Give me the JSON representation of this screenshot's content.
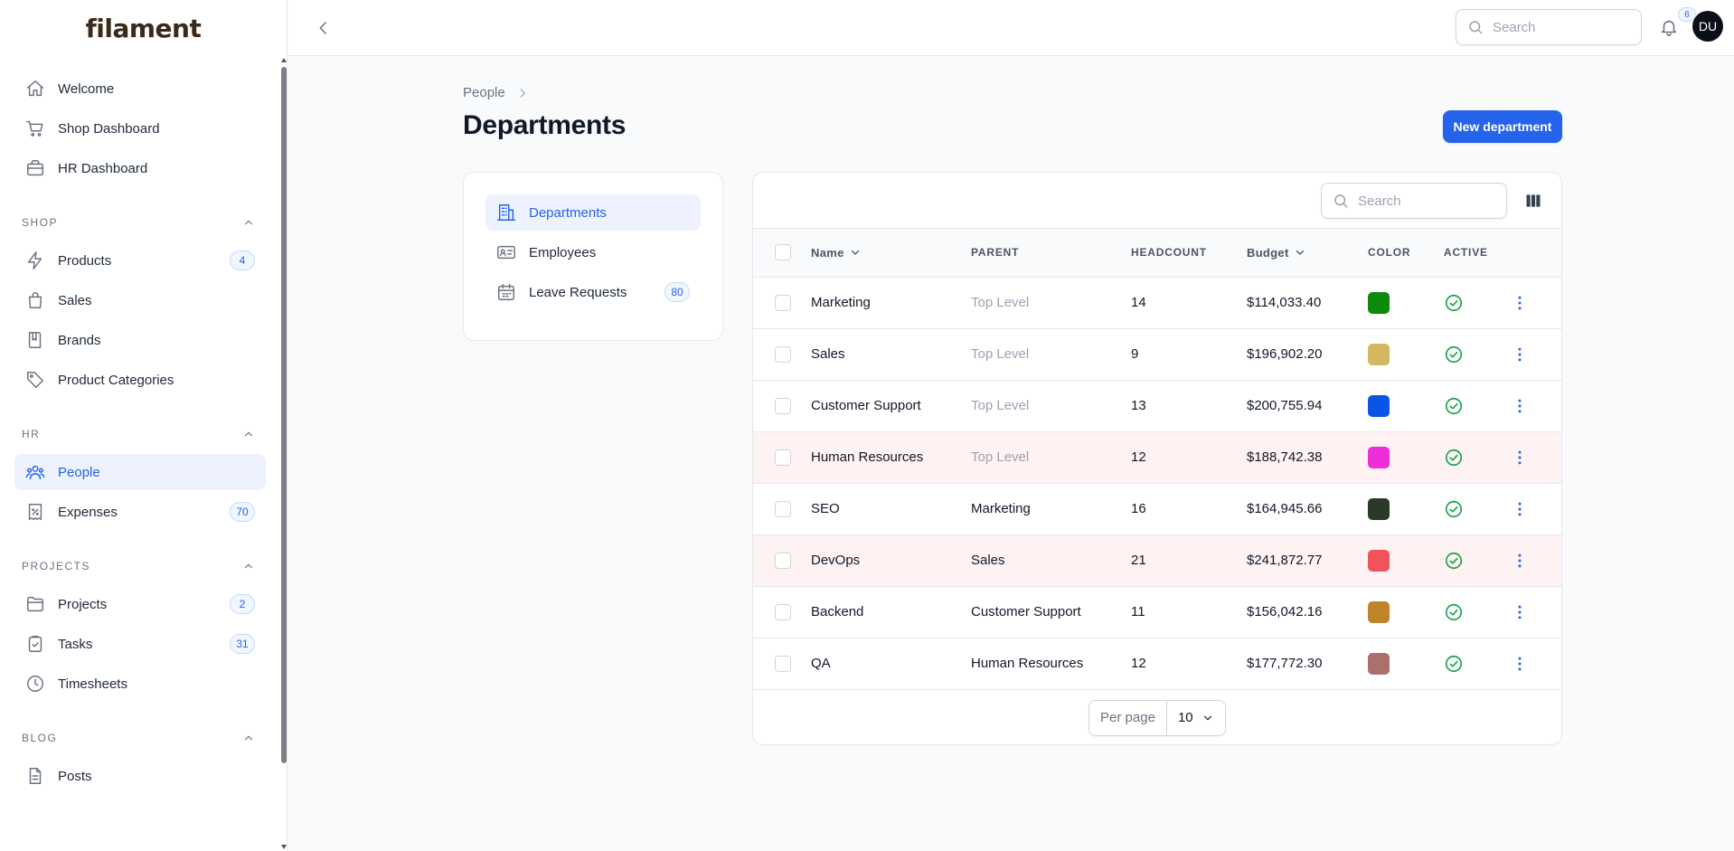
{
  "app": {
    "brand": "filament"
  },
  "sidebar": {
    "top_items": [
      {
        "label": "Welcome",
        "icon": "home-icon"
      },
      {
        "label": "Shop Dashboard",
        "icon": "cart-icon"
      },
      {
        "label": "HR Dashboard",
        "icon": "briefcase-icon"
      }
    ],
    "groups": [
      {
        "label": "SHOP",
        "items": [
          {
            "label": "Products",
            "icon": "bolt-icon",
            "badge": "4"
          },
          {
            "label": "Sales",
            "icon": "bag-icon"
          },
          {
            "label": "Brands",
            "icon": "book-icon"
          },
          {
            "label": "Product Categories",
            "icon": "tag-icon"
          }
        ]
      },
      {
        "label": "HR",
        "items": [
          {
            "label": "People",
            "icon": "users-icon",
            "active": true
          },
          {
            "label": "Expenses",
            "icon": "receipt-icon",
            "badge": "70"
          }
        ]
      },
      {
        "label": "PROJECTS",
        "items": [
          {
            "label": "Projects",
            "icon": "folder-icon",
            "badge": "2"
          },
          {
            "label": "Tasks",
            "icon": "clipboard-check-icon",
            "badge": "31"
          },
          {
            "label": "Timesheets",
            "icon": "clock-icon"
          }
        ]
      },
      {
        "label": "BLOG",
        "items": [
          {
            "label": "Posts",
            "icon": "document-icon"
          }
        ]
      }
    ]
  },
  "topbar": {
    "search_placeholder": "Search",
    "notifications_count": "6",
    "avatar_initials": "DU"
  },
  "header": {
    "breadcrumb": "People",
    "title": "Departments",
    "new_button": "New department"
  },
  "subnav": [
    {
      "label": "Departments",
      "icon": "building-icon",
      "active": true
    },
    {
      "label": "Employees",
      "icon": "id-card-icon"
    },
    {
      "label": "Leave Requests",
      "icon": "calendar-icon",
      "badge": "80"
    }
  ],
  "table": {
    "search_placeholder": "Search",
    "columns": {
      "name": "Name",
      "parent": "PARENT",
      "headcount": "HEADCOUNT",
      "budget": "Budget",
      "color": "COLOR",
      "active": "ACTIVE"
    },
    "rows": [
      {
        "name": "Marketing",
        "parent": "Top Level",
        "parent_muted": true,
        "headcount": "14",
        "budget": "$114,033.40",
        "color": "#0c8a0c",
        "highlight": false
      },
      {
        "name": "Sales",
        "parent": "Top Level",
        "parent_muted": true,
        "headcount": "9",
        "budget": "$196,902.20",
        "color": "#d4b860",
        "highlight": false
      },
      {
        "name": "Customer Support",
        "parent": "Top Level",
        "parent_muted": true,
        "headcount": "13",
        "budget": "$200,755.94",
        "color": "#0a55e6",
        "highlight": false
      },
      {
        "name": "Human Resources",
        "parent": "Top Level",
        "parent_muted": true,
        "headcount": "12",
        "budget": "$188,742.38",
        "color": "#ef2dd9",
        "highlight": true
      },
      {
        "name": "SEO",
        "parent": "Marketing",
        "parent_muted": false,
        "headcount": "16",
        "budget": "$164,945.66",
        "color": "#2b3a28",
        "highlight": false
      },
      {
        "name": "DevOps",
        "parent": "Sales",
        "parent_muted": false,
        "headcount": "21",
        "budget": "$241,872.77",
        "color": "#f0545a",
        "highlight": true
      },
      {
        "name": "Backend",
        "parent": "Customer Support",
        "parent_muted": false,
        "headcount": "11",
        "budget": "$156,042.16",
        "color": "#c0852a",
        "highlight": false
      },
      {
        "name": "QA",
        "parent": "Human Resources",
        "parent_muted": false,
        "headcount": "12",
        "budget": "$177,772.30",
        "color": "#a8716e",
        "highlight": false
      }
    ],
    "pagination": {
      "per_page_label": "Per page",
      "per_page_value": "10"
    }
  }
}
